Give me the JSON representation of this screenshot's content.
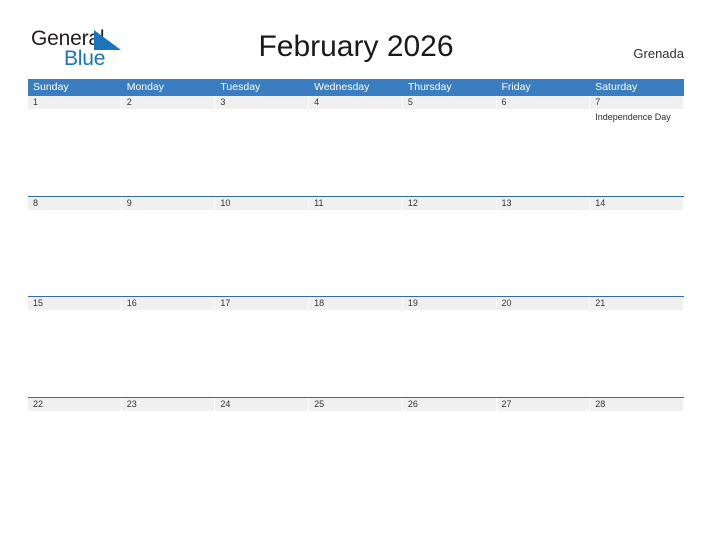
{
  "brand": {
    "name_part1": "General",
    "name_part2": "Blue",
    "flag_icon": "blue-triangle-flag-icon",
    "color_primary": "#1a75bb",
    "color_text": "#231f20"
  },
  "header": {
    "title": "February 2026",
    "region": "Grenada"
  },
  "calendar": {
    "header_background": "#3a7dc0",
    "date_bar_background": "#f0f0f0",
    "row_divider_color": "#2f6da8",
    "weekdays": [
      "Sunday",
      "Monday",
      "Tuesday",
      "Wednesday",
      "Thursday",
      "Friday",
      "Saturday"
    ],
    "weeks": [
      [
        {
          "day": "1",
          "events": []
        },
        {
          "day": "2",
          "events": []
        },
        {
          "day": "3",
          "events": []
        },
        {
          "day": "4",
          "events": []
        },
        {
          "day": "5",
          "events": []
        },
        {
          "day": "6",
          "events": []
        },
        {
          "day": "7",
          "events": [
            "Independence Day"
          ]
        }
      ],
      [
        {
          "day": "8",
          "events": []
        },
        {
          "day": "9",
          "events": []
        },
        {
          "day": "10",
          "events": []
        },
        {
          "day": "11",
          "events": []
        },
        {
          "day": "12",
          "events": []
        },
        {
          "day": "13",
          "events": []
        },
        {
          "day": "14",
          "events": []
        }
      ],
      [
        {
          "day": "15",
          "events": []
        },
        {
          "day": "16",
          "events": []
        },
        {
          "day": "17",
          "events": []
        },
        {
          "day": "18",
          "events": []
        },
        {
          "day": "19",
          "events": []
        },
        {
          "day": "20",
          "events": []
        },
        {
          "day": "21",
          "events": []
        }
      ],
      [
        {
          "day": "22",
          "events": []
        },
        {
          "day": "23",
          "events": []
        },
        {
          "day": "24",
          "events": []
        },
        {
          "day": "25",
          "events": []
        },
        {
          "day": "26",
          "events": []
        },
        {
          "day": "27",
          "events": []
        },
        {
          "day": "28",
          "events": []
        }
      ]
    ]
  }
}
